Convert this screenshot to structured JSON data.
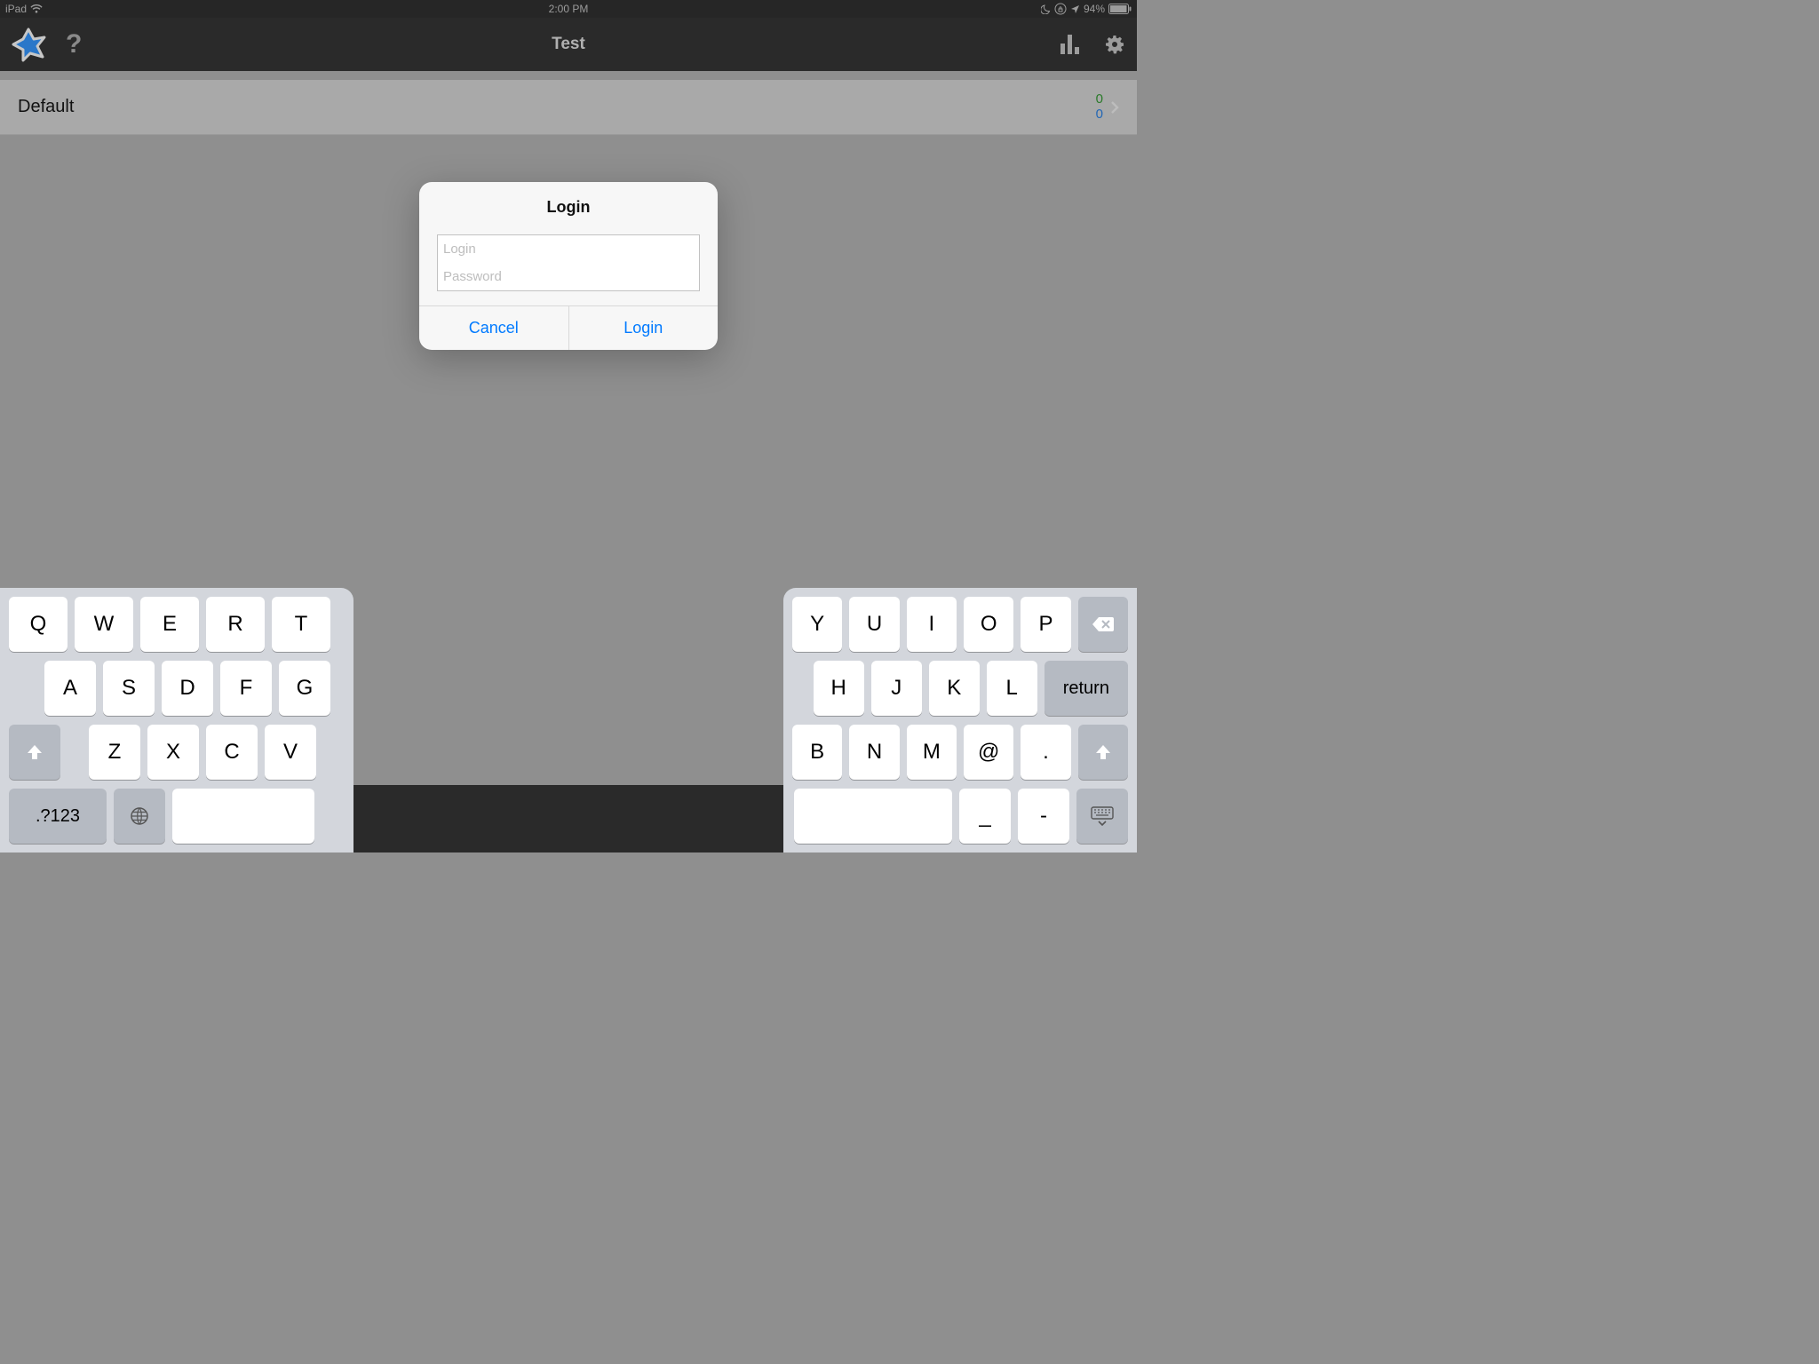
{
  "status": {
    "device": "iPad",
    "time": "2:00 PM",
    "battery": "94%"
  },
  "nav": {
    "title": "Test"
  },
  "list": {
    "row": {
      "label": "Default",
      "count_top": "0",
      "count_bot": "0"
    }
  },
  "dialog": {
    "title": "Login",
    "login_placeholder": "Login",
    "login_value": "",
    "password_placeholder": "Password",
    "password_value": "",
    "cancel_label": "Cancel",
    "login_label": "Login"
  },
  "keyboard": {
    "left": {
      "row1": [
        "Q",
        "W",
        "E",
        "R",
        "T"
      ],
      "row2": [
        "A",
        "S",
        "D",
        "F",
        "G"
      ],
      "row3_shift": "shift",
      "row3": [
        "Z",
        "X",
        "C",
        "V"
      ],
      "row4_mode": ".?123",
      "row4_globe": "globe",
      "row4_space": ""
    },
    "right": {
      "row1": [
        "Y",
        "U",
        "I",
        "O",
        "P"
      ],
      "row1_backspace": "backspace",
      "row2": [
        "H",
        "J",
        "K",
        "L"
      ],
      "row2_return": "return",
      "row3": [
        "B",
        "N",
        "M",
        "@",
        "."
      ],
      "row3_shift": "shift",
      "row4": [
        "_",
        "-"
      ],
      "row4_dismiss": "dismiss"
    }
  }
}
